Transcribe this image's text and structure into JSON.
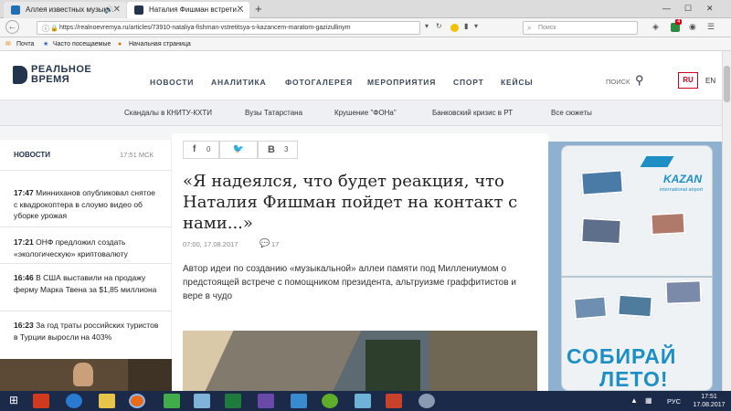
{
  "browser": {
    "tabs": [
      {
        "title": "Аллея известных музык…"
      },
      {
        "title": "Наталия Фишман встрети…"
      }
    ],
    "new_tab_label": "+",
    "url": "https://realnoevremya.ru/articles/73910-nataliya-fishman-vstretitsya-s-kazancem-maratom-gazizullinym",
    "search_placeholder": "Поиск",
    "notification_badge": "4",
    "bookmarks": [
      "Почта",
      "Часто посещаемые",
      "Начальная страница"
    ]
  },
  "site": {
    "logo_line1": "РЕАЛЬНОЕ",
    "logo_line2": "ВРЕМЯ",
    "nav": [
      "НОВОСТИ",
      "АНАЛИТИКА",
      "ФОТОГАЛЕРЕЯ",
      "МЕРОПРИЯТИЯ",
      "СПОРТ",
      "КЕЙСЫ"
    ],
    "search_label": "ПОИСК",
    "lang_ru": "RU",
    "lang_en": "EN",
    "subnav": [
      "Скандалы в КНИТУ-КХТИ",
      "Вузы Татарстана",
      "Крушение \"ФОНа\"",
      "Банковский кризис в РТ",
      "Все сюжеты"
    ]
  },
  "news": {
    "heading": "НОВОСТИ",
    "time": "17:51 МСК",
    "items": [
      {
        "time": "17:47",
        "text": "Минниханов опубликовал снятое с квадрокоптера в слоумо видео об уборке урожая"
      },
      {
        "time": "17:21",
        "text": "ОНФ предложил создать «экологическую» криптовалюту"
      },
      {
        "time": "16:46",
        "text": "В США выставили на продажу ферму Марка Твена за $1,85 миллиона"
      },
      {
        "time": "16:23",
        "text": "За год траты российских туристов в Турции выросли на 403%"
      }
    ]
  },
  "article": {
    "share_fb_count": "0",
    "share_vk_count": "3",
    "title": "«Я надеялся, что будет реакция, что Наталия Фишман пойдет на контакт с нами...»",
    "date": "07:00, 17.08.2017",
    "comments": "17",
    "lead": "Автор идеи по созданию «музыкальной» аллеи памяти под Миллениумом о предстоящей встрече с помощником президента, альтруизме граффитистов и вере в чудо"
  },
  "ad": {
    "brand": "KAZAN",
    "brand_sub": "international airport",
    "slogan_line1": "СОБИРАЙ",
    "slogan_line2": "ЛЕТО!"
  },
  "taskbar": {
    "lang": "РУС",
    "time": "17:51",
    "date": "17.08.2017"
  },
  "colors": {
    "brand": "#24344d",
    "accent_red": "#d0021b",
    "ad_blue": "#1d8fc4",
    "taskbar": "#1c2a4a"
  }
}
